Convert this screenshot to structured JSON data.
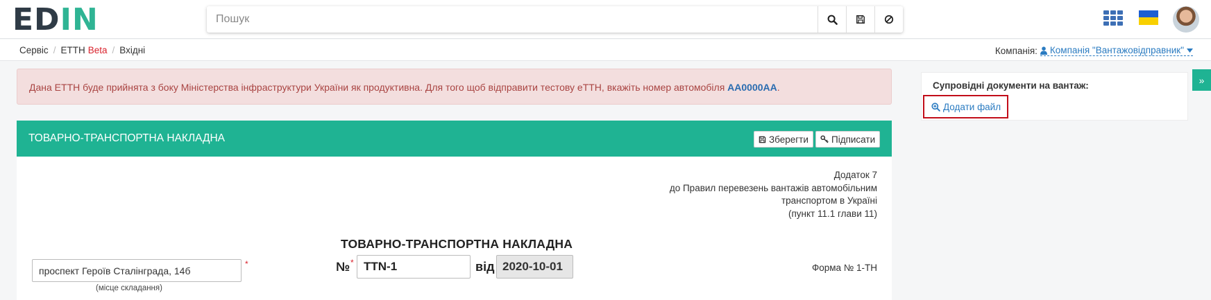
{
  "header": {
    "logo": {
      "part1": "ED",
      "part2": "IN"
    },
    "search": {
      "placeholder": "Пошук"
    },
    "icons": [
      "search-icon",
      "save-icon",
      "ban-icon",
      "apps-grid-icon",
      "ukraine-flag-icon",
      "user-avatar"
    ],
    "colors": {
      "brand_green": "#1fb393",
      "logo_dark": "#2f3b46",
      "link_blue": "#2a7bc1"
    }
  },
  "breadcrumb": {
    "items": [
      "Сервіс",
      "ЕТТН",
      "Вхідні"
    ],
    "beta": "Beta"
  },
  "company": {
    "label": "Компанія:",
    "value": "Компанія \"Вантажовідправник\""
  },
  "alert": {
    "text": "Дана ЕТТН буде прийнята з боку Міністерства інфраструктури України як продуктивна. Для того щоб відправити тестову еТТН, вкажіть номер автомобіля ",
    "highlight": "AA0000AA",
    "end": ".",
    "colors": {
      "bg": "#f3dede",
      "text": "#a94442"
    }
  },
  "panel": {
    "title": "ТОВАРНО-ТРАНСПОРТНА НАКЛАДНА",
    "save_label": "Зберегти",
    "sign_label": "Підписати",
    "appendix": [
      "Додаток 7",
      "до Правил перевезень вантажів автомобільним",
      "транспортом в Україні",
      "(пункт 11.1 глави 11)"
    ],
    "doc_title": "ТОВАРНО-ТРАНСПОРТНА НАКЛАДНА",
    "address_value": "проспект Героїв Сталінграда, 14б",
    "address_caption": "(місце складання)",
    "number_label": "№",
    "number_value": "TTN-1",
    "date_label": "від",
    "date_value": "2020-10-01",
    "form_no": "Форма № 1-ТН",
    "required_mark": "*"
  },
  "sidebar": {
    "title": "Супровідні документи на вантаж:",
    "add_file": "Додати файл",
    "collapse_icon": "chevron-double-right-icon"
  }
}
